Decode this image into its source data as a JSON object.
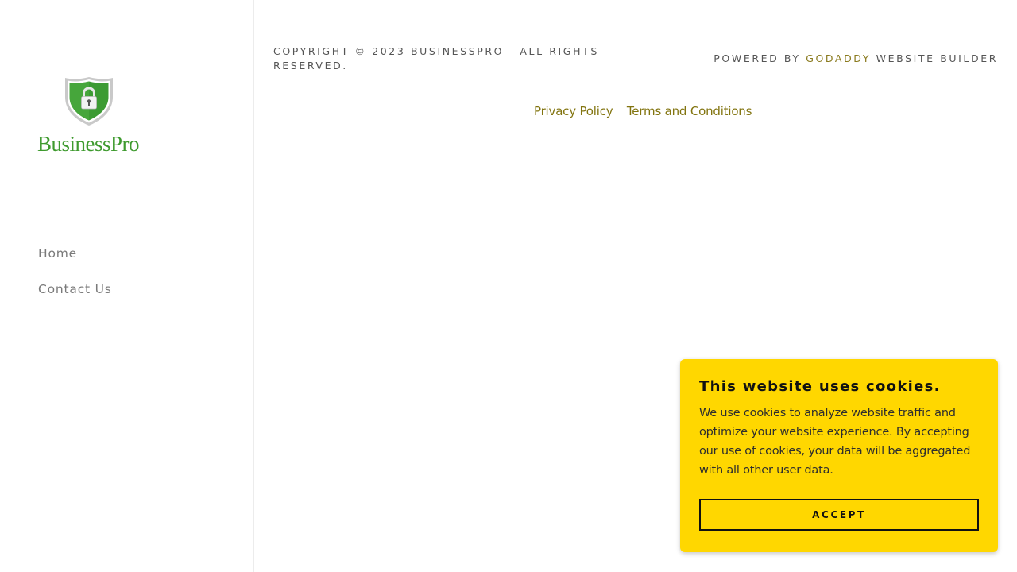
{
  "brand": {
    "name": "BusinessPro",
    "logo_icon": "shield-lock-icon",
    "colors": {
      "green": "#3e9a2e",
      "shield_rim": "#c8c8c8"
    }
  },
  "nav": {
    "items": [
      {
        "label": "Home"
      },
      {
        "label": "Contact Us"
      }
    ]
  },
  "footer": {
    "copyright": "COPYRIGHT © 2023 BUSINESSPRO - ALL RIGHTS RESERVED.",
    "powered_prefix": "POWERED BY ",
    "powered_link": "GODADDY",
    "powered_suffix": " WEBSITE BUILDER",
    "links": [
      {
        "label": "Privacy Policy"
      },
      {
        "label": "Terms and Conditions"
      }
    ]
  },
  "cookie_banner": {
    "title": "This website uses cookies.",
    "body": "We use cookies to analyze website traffic and optimize your website experience. By accepting our use of cookies, your data will be aggregated with all other user data.",
    "accept_label": "ACCEPT",
    "background": "#ffd700"
  }
}
